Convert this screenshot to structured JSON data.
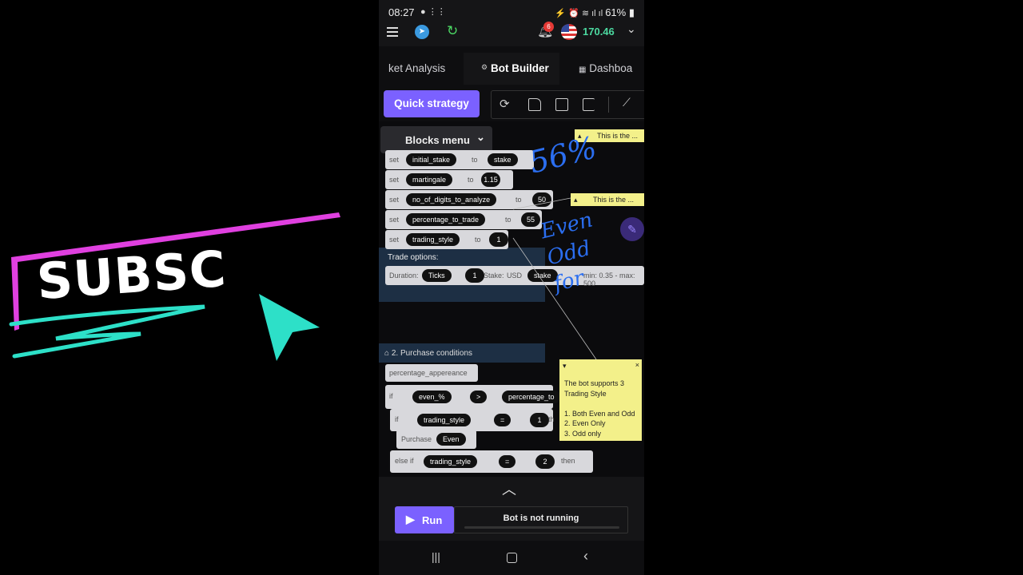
{
  "overlay": {
    "subscribe_text": "SUBSC",
    "colors": {
      "frame": "#e040e0",
      "accent": "#2de0c8"
    }
  },
  "status_bar": {
    "time": "08:27",
    "battery": "61%"
  },
  "header": {
    "notification_count": "6",
    "balance": "170.46",
    "icons": [
      "menu-icon",
      "telegram-icon",
      "refresh-icon",
      "bell-icon",
      "us-flag-icon",
      "chevron-down-icon"
    ]
  },
  "tabs": [
    {
      "label": "ket Analysis"
    },
    {
      "label": "Bot Builder"
    },
    {
      "label": "Dashboa"
    }
  ],
  "toolbar": {
    "quick_strategy_label": "Quick strategy",
    "icons": [
      "reset-icon",
      "open-icon",
      "save-icon",
      "sort-icon",
      "chart-icon"
    ]
  },
  "blocks_menu": {
    "label": "Blocks menu"
  },
  "variables": [
    {
      "set": "set",
      "name": "initial_stake",
      "to": "to",
      "value": "stake"
    },
    {
      "set": "set",
      "name": "martingale",
      "to": "to",
      "value": "1.15"
    },
    {
      "set": "set",
      "name": "no_of_digits_to_analyze",
      "to": "to",
      "value": "50"
    },
    {
      "set": "set",
      "name": "percentage_to_trade",
      "to": "to",
      "value": "55"
    },
    {
      "set": "set",
      "name": "trading_style",
      "to": "to",
      "value": "1"
    }
  ],
  "trade_options": {
    "title": "Trade options:",
    "duration_label": "Duration:",
    "duration_unit": "Ticks",
    "duration_value": "1",
    "stake_label": "Stake:",
    "currency": "USD",
    "stake_value": "stake",
    "limits": "min: 0.35 - max: 500"
  },
  "notes": {
    "note1": "This is the ...",
    "note2": "This is the ...",
    "note3_lines": [
      "The bot supports 3",
      "Trading Style",
      "",
      "1. Both Even and Odd",
      "2. Even Only",
      "3. Odd only"
    ]
  },
  "handwriting": {
    "percent": "56%",
    "words": "Even Odd for"
  },
  "purchase": {
    "title": "2. Purchase conditions",
    "var_block": "percentage_appereance",
    "if1": {
      "kw": "if",
      "left": "even_%",
      "op": ">",
      "right": "percentage_to"
    },
    "if2": {
      "kw": "if",
      "left": "trading_style",
      "op": "=",
      "right": "1",
      "then": "th"
    },
    "purchase_label": "Purchase",
    "purchase_value": "Even",
    "elseif": {
      "kw": "else if",
      "left": "trading_style",
      "op": "=",
      "right": "2",
      "then": "then"
    }
  },
  "run": {
    "run_label": "Run",
    "status_text": "Bot is not running"
  }
}
